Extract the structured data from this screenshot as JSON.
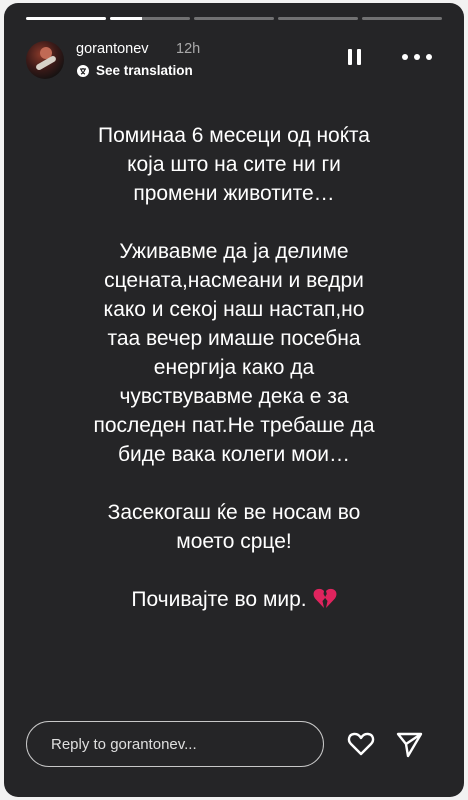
{
  "story": {
    "progress": [
      {
        "fill_fraction": 1.0
      },
      {
        "fill_fraction": 0.4
      },
      {
        "fill_fraction": 0.0
      },
      {
        "fill_fraction": 0.0
      },
      {
        "fill_fraction": 0.0
      }
    ]
  },
  "header": {
    "username": "gorantonev",
    "time_ago": "12h",
    "see_translation": "See translation",
    "avatar_icon": "user-avatar-photo",
    "translate_icon": "translate-icon",
    "pause_icon": "pause-icon",
    "more_icon": "more-options-icon"
  },
  "content": {
    "paragraphs": [
      "Поминаа 6 месеци од ноќта\nкоја што на сите ни ги\nпромени животите…",
      "Уживавме да ја делиме\nсцената,насмеани и ведри\nкако и секој наш настап,но\nтаа вечер имаше посебна\nенергија како да\nчувствувавме дека е за\nпоследен пат.Не требаше да\nбиде вака колеги мои…",
      "Засекогаш ќе ве носам во\nмоето срце!",
      "Почивајте во мир."
    ],
    "emoji_icon": "broken-heart-icon",
    "emoji_color": "#e0245e"
  },
  "footer": {
    "reply_placeholder": "Reply to gorantonev...",
    "like_icon": "heart-outline-icon",
    "send_icon": "send-icon"
  },
  "colors": {
    "background": "#252527",
    "page_background": "#f2f2f2",
    "text": "#ffffff"
  }
}
